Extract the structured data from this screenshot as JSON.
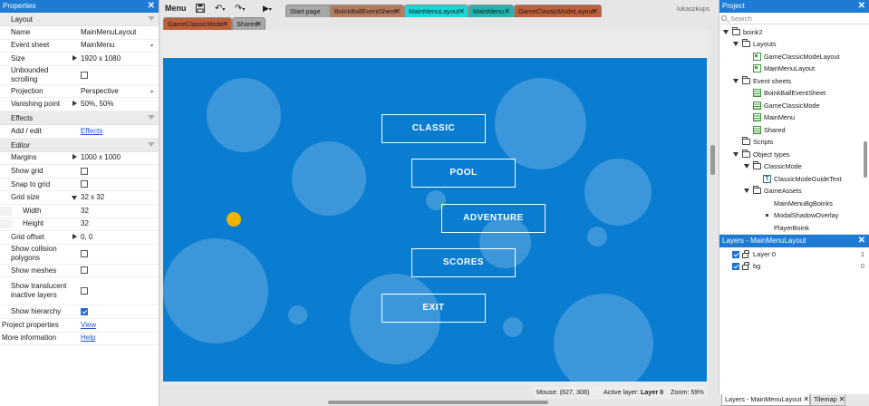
{
  "properties": {
    "title": "Properties",
    "close": "✕",
    "sections": {
      "layout": "Layout",
      "effects": "Effects",
      "editor": "Editor"
    },
    "rows": {
      "name_label": "Name",
      "name_value": "MainMenuLayout",
      "eventsheet_label": "Event sheet",
      "eventsheet_value": "MainMenu",
      "size_label": "Size",
      "size_value": "1920 x 1080",
      "unbounded_label": "Unbounded scrolling",
      "projection_label": "Projection",
      "projection_value": "Perspective",
      "vanishing_label": "Vanishing point",
      "vanishing_value": "50%, 50%",
      "addedit_label": "Add / edit",
      "addedit_value": "Effects",
      "margins_label": "Margins",
      "margins_value": "1000 x 1000",
      "showgrid_label": "Show grid",
      "snaptogrid_label": "Snap to grid",
      "gridsize_label": "Grid size",
      "gridsize_value": "32 x 32",
      "width_label": "Width",
      "width_value": "32",
      "height_label": "Height",
      "height_value": "32",
      "gridoffset_label": "Grid offset",
      "gridoffset_value": "0, 0",
      "collision_label": "Show collision polygons",
      "meshes_label": "Show meshes",
      "translucent_label": "Show translucent inactive layers",
      "hierarchy_label": "Show hierarchy",
      "projprops_label": "Project properties",
      "projprops_value": "View",
      "moreinfo_label": "More information",
      "moreinfo_value": "Help"
    },
    "dropdown_glyph": "⌄"
  },
  "toolbar": {
    "menu": "Menu",
    "save_icon": "save-icon",
    "undo_glyph": "↶",
    "redo_glyph": "↷",
    "play_glyph": "▶",
    "caret": "▾",
    "user": "lukaszkups",
    "tabs": [
      {
        "label": "Start page",
        "x": "✕"
      },
      {
        "label": "BoinkBallEventSheet",
        "x": "✕"
      },
      {
        "label": "MainMenuLayout",
        "x": "✕"
      },
      {
        "label": "MainMenu",
        "x": "✕"
      },
      {
        "label": "GameClassicModeLayout",
        "x": "✕"
      },
      {
        "label": "GameClassicMode",
        "x": "✕"
      },
      {
        "label": "Shared",
        "x": "✕"
      }
    ]
  },
  "game": {
    "buttons": [
      "CLASSIC",
      "POOL",
      "ADVENTURE",
      "SCORES",
      "EXIT"
    ],
    "background_color": "#0a7dd1",
    "dot_color": "#f0b400"
  },
  "status": {
    "mouse": "Mouse: (627, 308)",
    "active_layer_prefix": "Active layer:",
    "active_layer": "Layer 0",
    "zoom": "Zoom: 59%"
  },
  "project": {
    "title": "Project",
    "close": "✕",
    "search_placeholder": "Search",
    "tree": [
      "boink2",
      "Layouts",
      "GameClassicModeLayout",
      "MainMenuLayout",
      "Event sheets",
      "BoinkBallEventSheet",
      "GameClassicMode",
      "MainMenu",
      "Shared",
      "Scripts",
      "Object types",
      "ClassicMode",
      "ClassicModeGuideText",
      "GameAssets",
      "MainMenuBgBoinks",
      "ModalShadowOverlay",
      "PlayerBoink"
    ]
  },
  "layers": {
    "title": "Layers - MainMenuLayout",
    "close": "✕",
    "rows": [
      {
        "name": "Layer 0",
        "num": "1"
      },
      {
        "name": "bg",
        "num": "0"
      }
    ]
  },
  "bottom_tabs": [
    {
      "label": "Layers - MainMenuLayout",
      "x": "✕"
    },
    {
      "label": "Tilemap",
      "x": "✕"
    }
  ]
}
